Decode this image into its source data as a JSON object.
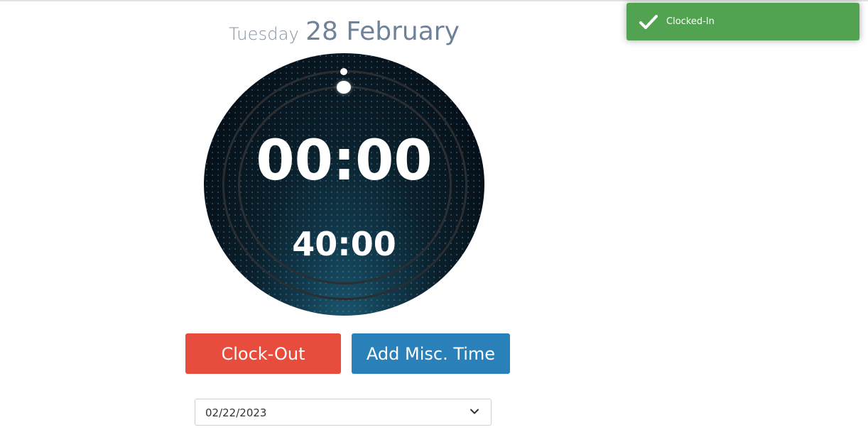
{
  "date": {
    "weekday": "Tuesday",
    "day_month": "28 February"
  },
  "clock": {
    "elapsed": "00:00",
    "target": "40:00"
  },
  "buttons": {
    "clock_out": "Clock-Out",
    "add_misc_time": "Add Misc. Time"
  },
  "date_select": {
    "value": "02/22/2023"
  },
  "toast": {
    "message": "Clocked-In",
    "icon": "check-icon",
    "color": "#51a351"
  },
  "colors": {
    "clock_out": "#e74c3c",
    "add_misc": "#2a80b9"
  }
}
